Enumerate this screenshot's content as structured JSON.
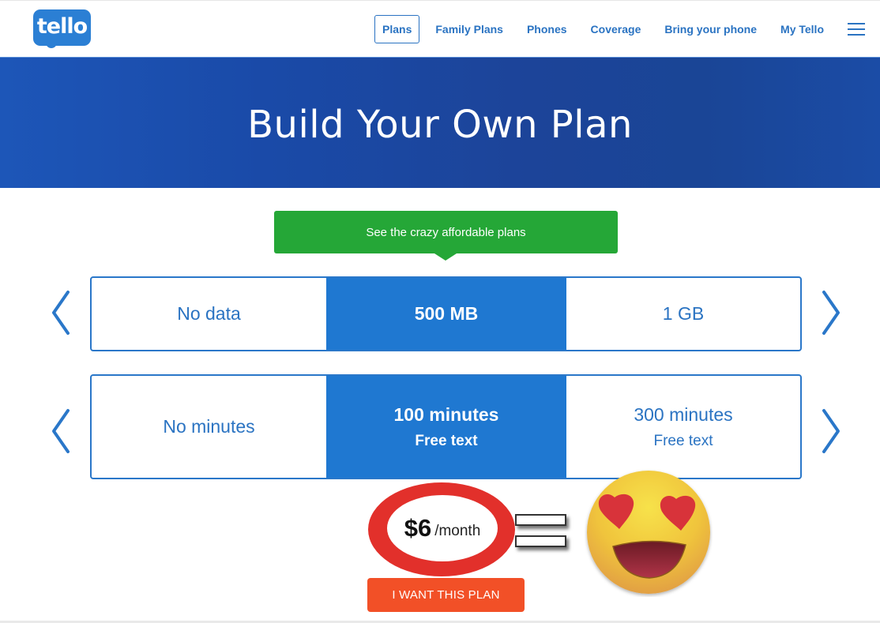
{
  "header": {
    "logo_text": "tello",
    "nav": [
      {
        "label": "Plans",
        "active": true
      },
      {
        "label": "Family Plans"
      },
      {
        "label": "Phones"
      },
      {
        "label": "Coverage"
      },
      {
        "label": "Bring your phone"
      },
      {
        "label": "My Tello"
      }
    ],
    "menu_icon": "hamburger-menu-icon"
  },
  "banner": {
    "title": "Build Your Own Plan"
  },
  "tooltip": {
    "text": "See the crazy affordable plans"
  },
  "data_selector": {
    "prev_icon": "chevron-left-icon",
    "next_icon": "chevron-right-icon",
    "options": [
      {
        "label": "No data"
      },
      {
        "label": "500 MB",
        "selected": true
      },
      {
        "label": "1 GB"
      }
    ]
  },
  "minutes_selector": {
    "prev_icon": "chevron-left-icon",
    "next_icon": "chevron-right-icon",
    "options": [
      {
        "label": "No minutes",
        "sub": ""
      },
      {
        "label": "100 minutes",
        "sub": "Free text",
        "selected": true
      },
      {
        "label": "300 minutes",
        "sub": "Free text"
      }
    ]
  },
  "price": {
    "amount": "$6",
    "unit": "/month"
  },
  "annotation": {
    "equals_icon": "equals-sign-icon",
    "emoji": "heart-eyes-emoji-icon"
  },
  "cta": {
    "label": "I WANT THIS PLAN"
  },
  "colors": {
    "brand_blue": "#2a73c2",
    "selected_blue": "#1f78d1",
    "banner_blue": "#1a4aa8",
    "tooltip_green": "#25a737",
    "cta_orange": "#f25027",
    "ring_red": "#e2302b"
  }
}
